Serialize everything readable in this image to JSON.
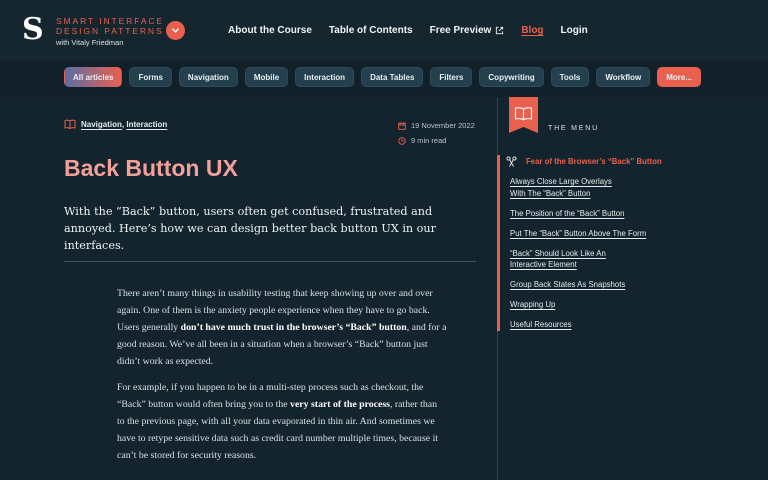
{
  "brand": {
    "logo_letter": "S",
    "line1": "SMART INTERFACE",
    "line2": "DESIGN PATTERNS",
    "line3": "with Vitaly Friedman"
  },
  "nav": {
    "items": [
      "About the Course",
      "Table of Contents",
      "Free Preview",
      "Blog",
      "Login"
    ]
  },
  "categories": [
    "All articles",
    "Forms",
    "Navigation",
    "Mobile",
    "Interaction",
    "Data Tables",
    "Filters",
    "Copywriting",
    "Tools",
    "Workflow",
    "More..."
  ],
  "article": {
    "tag1": "Navigation",
    "tag_sep": ",",
    "tag2": "Interaction",
    "date": "19 November 2022",
    "read_time": "9 min read",
    "title": "Back Button UX",
    "lead": "With the “Back” button, users often get confused, frustrated and annoyed. Here’s how we can design better back button UX in our interfaces.",
    "p1_a": "There aren’t many things in usability testing that keep showing up over and over again. One of them is the anxiety people experience when they have to go back. Users generally ",
    "p1_b": "don’t have much trust in the browser’s “Back” button",
    "p1_c": ", and for a good reason. We’ve all been in a situation when a browser’s “Back” button just didn’t work as expected.",
    "p2_a": "For example, if you happen to be in a multi-step process such as checkout, the “Back” button would often bring you to the ",
    "p2_b": "very start of the process",
    "p2_c": ", rather than to the previous page, with all your data evaporated in thin air. And sometimes we have to retype sensitive data such as credit card number multiple times, because it can’t be stored for security reasons."
  },
  "sidebar": {
    "heading": "THE MENU",
    "toc": [
      "Fear of the Browser’s “Back” Button",
      "Always Close Large Overlays With The “Back” Button",
      "The Position of the “Back” Button",
      "Put The “Back” Button Above The Form",
      "“Back” Should Look Like An Interactive Element",
      "Group Back States As Snapshots",
      "Wrapping Up",
      "Useful Resources"
    ]
  },
  "colors": {
    "accent": "#e9604f",
    "background": "#13242e",
    "title": "#f2a19a"
  }
}
